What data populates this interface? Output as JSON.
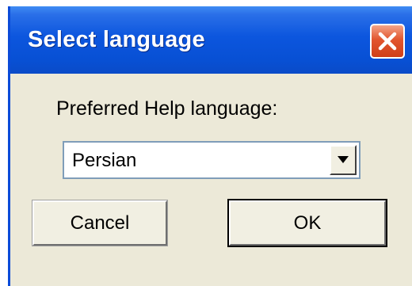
{
  "window": {
    "title": "Select language",
    "close_icon": "close-icon"
  },
  "dialog": {
    "prompt": "Preferred Help language:",
    "language_select": {
      "value": "Persian",
      "dropdown_icon": "chevron-down-icon"
    },
    "cancel_label": "Cancel",
    "ok_label": "OK"
  },
  "colors": {
    "titlebar": "#0850d4",
    "dialog_bg": "#ece9d8",
    "close_button": "#e2562f",
    "field_border": "#7f9db9"
  }
}
